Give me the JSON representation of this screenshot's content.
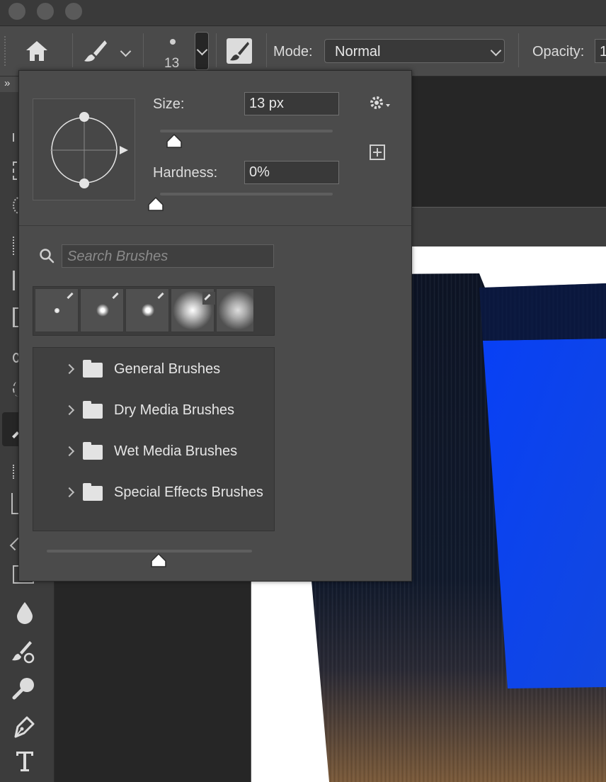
{
  "options_bar": {
    "brush_size_value": "13",
    "mode_label": "Mode:",
    "mode_value": "Normal",
    "opacity_label": "Opacity:",
    "opacity_value": "1"
  },
  "brush_panel": {
    "size_label": "Size:",
    "size_value": "13 px",
    "size_level": 0.05,
    "hardness_label": "Hardness:",
    "hardness_value": "0%",
    "hardness_level": 0.0,
    "search_placeholder": "Search Brushes",
    "folders": [
      {
        "label": "General Brushes"
      },
      {
        "label": "Dry Media Brushes"
      },
      {
        "label": "Wet Media Brushes"
      },
      {
        "label": "Special Effects Brushes"
      }
    ]
  },
  "colors": {
    "accent_blue": "#0b3df0",
    "panel_bg": "#4b4b4b",
    "toolbar_bg": "#3c3c3c"
  },
  "icons": [
    "home-icon",
    "brush-tool-icon",
    "brush-preset-icon",
    "airbrush-toggle-icon",
    "gear-icon",
    "new-preset-icon",
    "search-icon",
    "folder-icon",
    "blur-tool-icon",
    "color-replace-icon",
    "zoom-tool-icon",
    "pen-tool-icon",
    "type-tool-icon"
  ]
}
